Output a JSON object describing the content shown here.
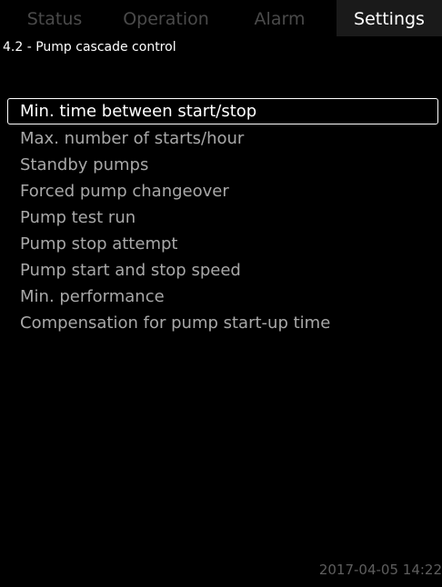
{
  "tabs": [
    {
      "label": "Status"
    },
    {
      "label": "Operation"
    },
    {
      "label": "Alarm"
    },
    {
      "label": "Settings"
    }
  ],
  "active_tab": "Settings",
  "page_title": "4.2 - Pump cascade control",
  "menu": {
    "items": [
      {
        "label": "Min. time between start/stop",
        "selected": true
      },
      {
        "label": "Max. number of starts/hour"
      },
      {
        "label": "Standby pumps"
      },
      {
        "label": "Forced pump changeover"
      },
      {
        "label": "Pump test run"
      },
      {
        "label": "Pump stop attempt"
      },
      {
        "label": "Pump start and stop speed"
      },
      {
        "label": "Min. performance"
      },
      {
        "label": "Compensation for pump start-up time"
      }
    ]
  },
  "footer": {
    "datetime": "2017-04-05 14:22"
  },
  "colors": {
    "background": "#000000",
    "active_tab_bg": "#1a1a1a",
    "inactive_tab_text": "#4a4a4a",
    "menu_text": "#a8a8a8",
    "selected_text": "#ffffff"
  }
}
